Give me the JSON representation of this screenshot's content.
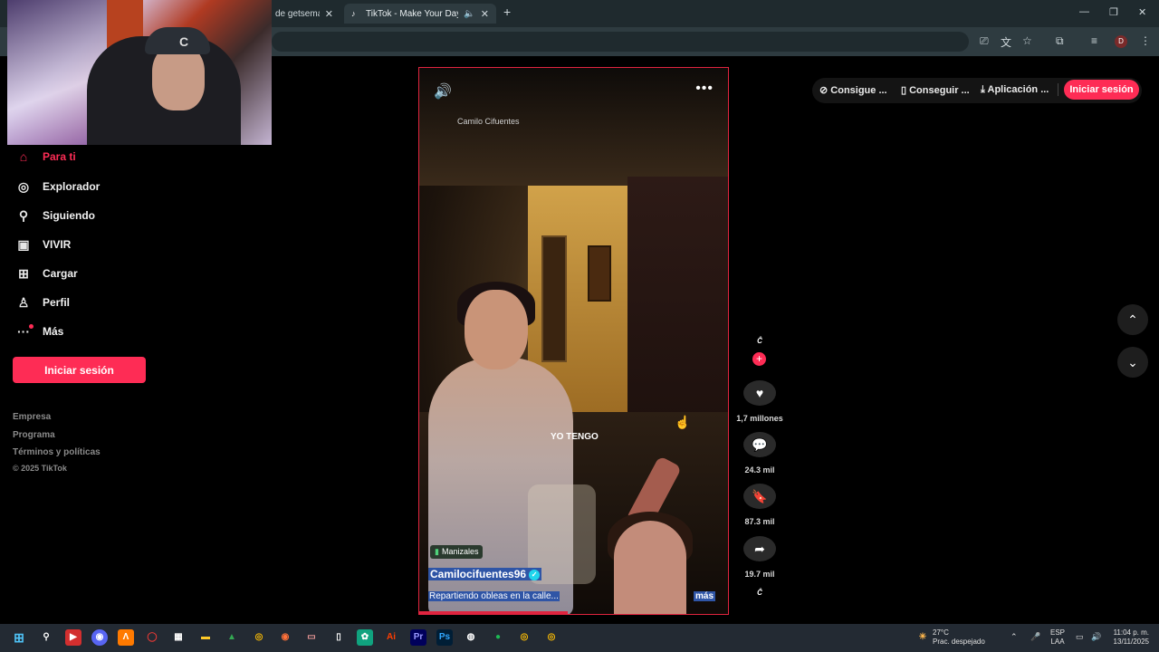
{
  "browser": {
    "tabs": [
      {
        "title": "de getseman"
      },
      {
        "title": "TikTok - Make Your Day"
      }
    ],
    "profile_initial": "D"
  },
  "sidebar": {
    "items": [
      {
        "label": "Para ti",
        "icon": "home-icon"
      },
      {
        "label": "Explorador",
        "icon": "compass-icon"
      },
      {
        "label": "Siguiendo",
        "icon": "user-follow-icon"
      },
      {
        "label": "VIVIR",
        "icon": "live-icon"
      },
      {
        "label": "Cargar",
        "icon": "upload-icon"
      },
      {
        "label": "Perfil",
        "icon": "profile-icon"
      },
      {
        "label": "Más",
        "icon": "more-icon"
      }
    ],
    "login_label": "Iniciar sesión",
    "footer": [
      "Empresa",
      "Programa",
      "Términos y políticas"
    ],
    "copyright": "© 2025 TikTok"
  },
  "video": {
    "watermark": "Camilo Cifuentes",
    "caption": "YO TENGO",
    "location": "Manizales",
    "author": "Camilocifuentes96",
    "description": "Repartiendo obleas en la calle...",
    "more_label": "más",
    "progress": 0.48
  },
  "actions": {
    "likes": "1,7 millones",
    "comments": "24.3 mil",
    "saves": "87.3 mil",
    "shares": "19.7 mil"
  },
  "topbar": {
    "item1": "Consigue ...",
    "item2": "Conseguir ...",
    "item3": "Aplicación ...",
    "login_label": "Iniciar sesión"
  },
  "taskbar": {
    "temperature": "27°C",
    "weather": "Prac. despejado",
    "lang1": "ESP",
    "lang2": "LAA",
    "time": "11:04 p. m.",
    "date": "13/11/2025"
  },
  "colors": {
    "accent": "#fe2c55",
    "video_border": "#e0243f"
  }
}
